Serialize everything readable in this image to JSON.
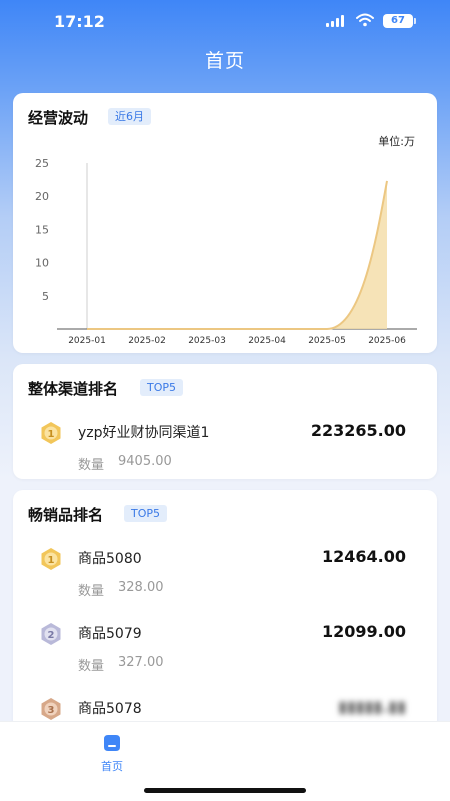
{
  "status": {
    "time": "17:12",
    "battery": "67"
  },
  "nav": {
    "title": "首页"
  },
  "trend_card": {
    "title": "经营波动",
    "tag": "近6月",
    "unit": "单位:万"
  },
  "chart_data": {
    "type": "area",
    "x": [
      "2025-01",
      "2025-02",
      "2025-03",
      "2025-04",
      "2025-05",
      "2025-06"
    ],
    "series": [
      {
        "values": [
          0,
          0,
          0,
          0,
          0,
          22.3
        ]
      }
    ],
    "ylim": [
      0,
      25
    ],
    "yticks": [
      5,
      10,
      15,
      20,
      25
    ],
    "color": "#f5deaa",
    "line_color": "#ecc782",
    "grid": false
  },
  "channel_card": {
    "title": "整体渠道排名",
    "tag": "TOP5",
    "items": [
      {
        "rank": "1",
        "name": "yzp好业财协同渠道1",
        "amount": "223265.00",
        "qty_label": "数量",
        "qty": "9405.00"
      }
    ]
  },
  "bestseller_card": {
    "title": "畅销品排名",
    "tag": "TOP5",
    "items": [
      {
        "rank": "1",
        "name": "商品5080",
        "amount": "12464.00",
        "qty_label": "数量",
        "qty": "328.00"
      },
      {
        "rank": "2",
        "name": "商品5079",
        "amount": "12099.00",
        "qty_label": "数量",
        "qty": "327.00"
      },
      {
        "rank": "3",
        "name": "商品5078",
        "amount": "",
        "qty_label": "",
        "qty": ""
      }
    ]
  },
  "tabbar": {
    "home_label": "首页"
  },
  "colors": {
    "primary": "#3f86f7",
    "medal_gold": "#f2c65a",
    "medal_silver": "#b9b9d9",
    "medal_bronze": "#d7a889"
  }
}
